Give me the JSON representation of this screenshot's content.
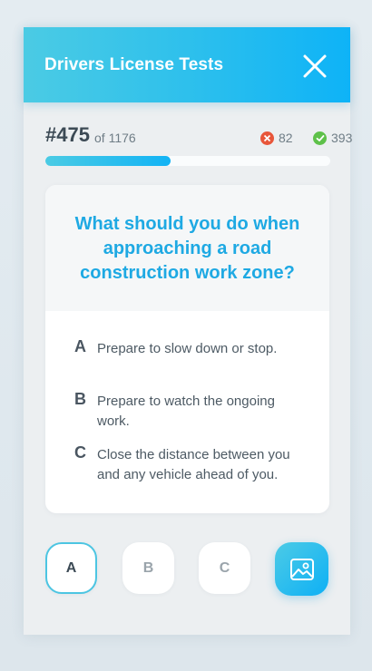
{
  "header": {
    "title": "Drivers License Tests",
    "close_icon": "close-icon"
  },
  "progress": {
    "question_number": "#475",
    "of_total": "of 1176",
    "wrong_count": "82",
    "correct_count": "393",
    "fraction": 0.44,
    "accent": "#1ab5f2",
    "wrong_color": "#e8563a",
    "correct_color": "#5ec14a"
  },
  "question": {
    "text": "What should you do when approaching a road construction work zone?",
    "color": "#1ea9e3"
  },
  "answers": [
    {
      "letter": "A",
      "text": "Prepare to slow down or stop."
    },
    {
      "letter": "B",
      "text": "Prepare to watch the ongoing work."
    },
    {
      "letter": "C",
      "text": "Close the distance between you and any vehicle ahead of you."
    }
  ],
  "choices": [
    {
      "label": "A",
      "selected": true
    },
    {
      "label": "B",
      "selected": false
    },
    {
      "label": "C",
      "selected": false
    }
  ],
  "image_button": {
    "icon": "image-icon"
  }
}
